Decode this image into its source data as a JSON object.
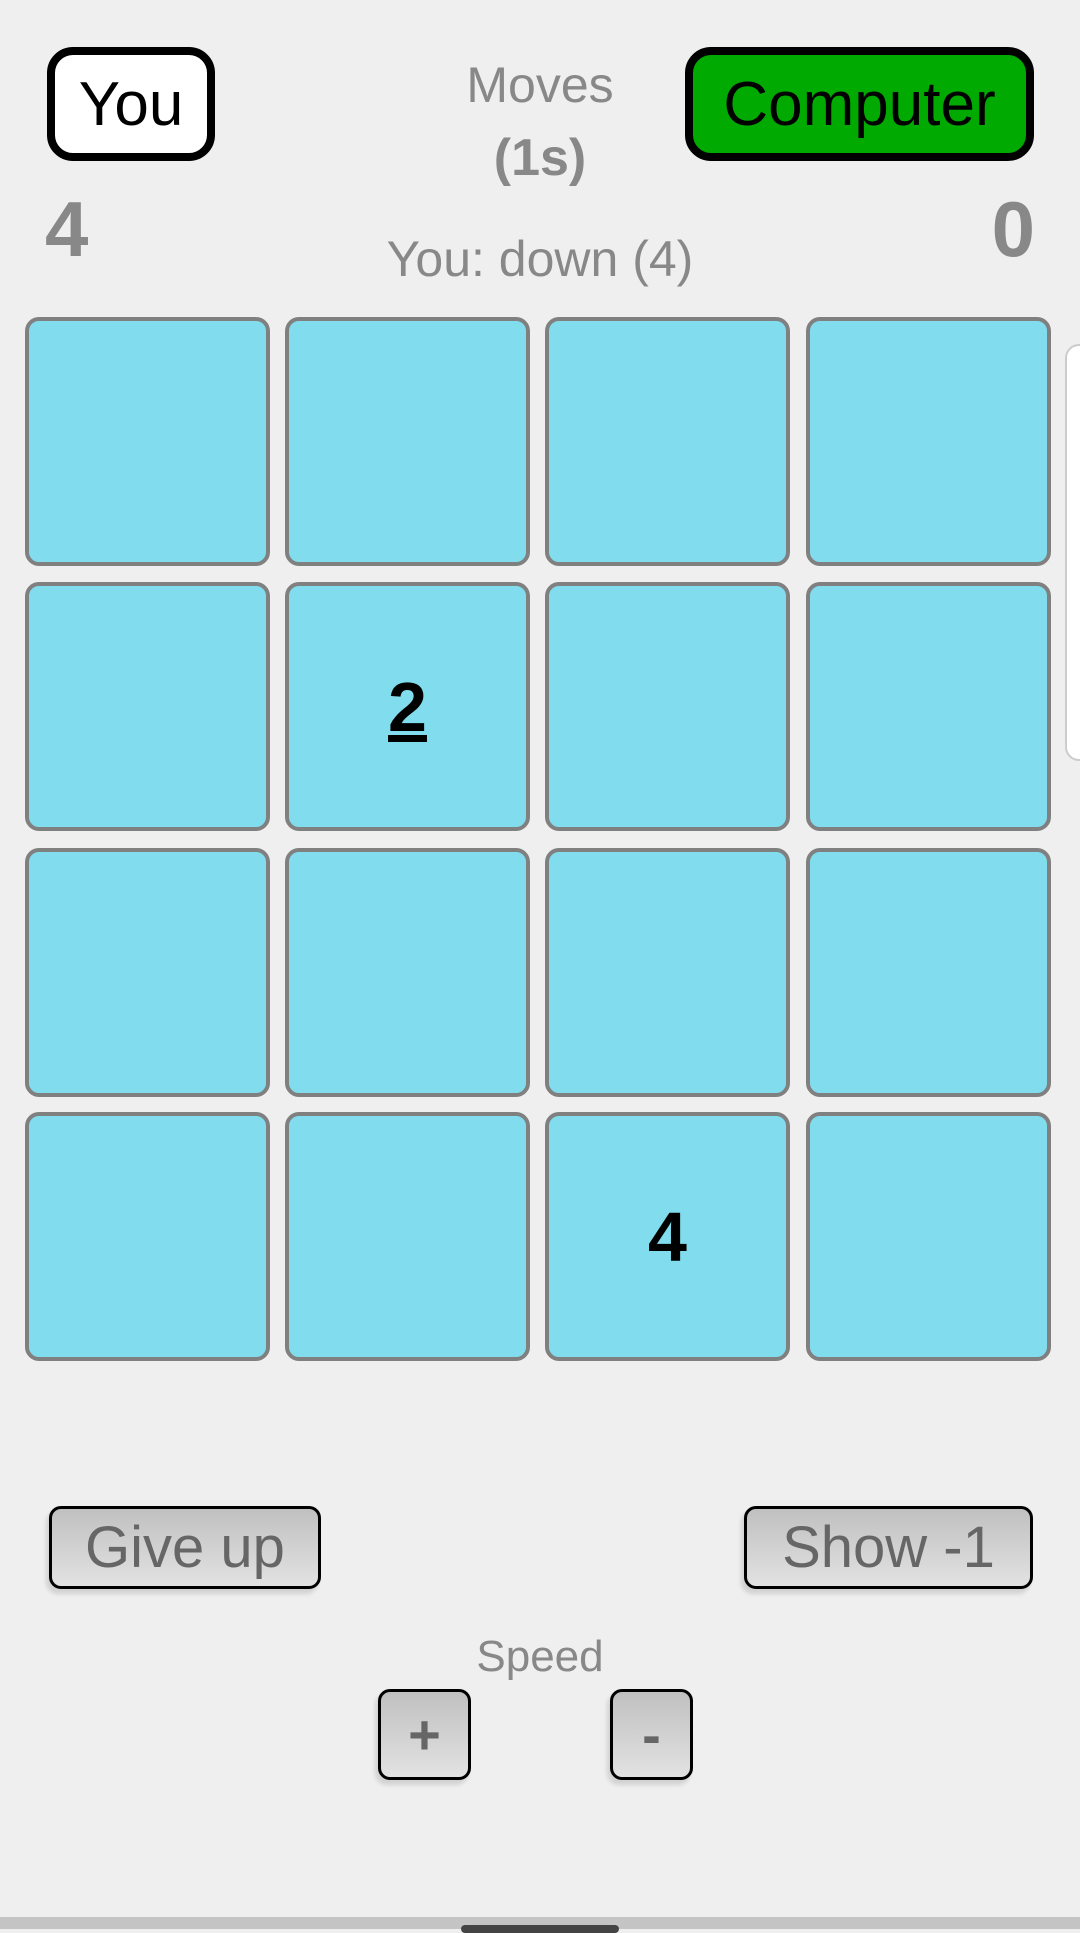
{
  "players": {
    "you": {
      "label": "You",
      "score": "4"
    },
    "computer": {
      "label": "Computer",
      "score": "0",
      "active_color": "#00aa00"
    }
  },
  "moves": {
    "label": "Moves",
    "time": "(1s)",
    "last_move": "You: down (4)"
  },
  "board": {
    "tile_color": "#81ddee",
    "rows": [
      [
        "",
        "",
        "",
        ""
      ],
      [
        "",
        "2",
        "",
        ""
      ],
      [
        "",
        "",
        "",
        ""
      ],
      [
        "",
        "",
        "4",
        ""
      ]
    ],
    "underlined_tile": "2"
  },
  "buttons": {
    "give_up": "Give up",
    "show": "Show -1"
  },
  "speed": {
    "label": "Speed",
    "plus": "+",
    "minus": "-"
  }
}
